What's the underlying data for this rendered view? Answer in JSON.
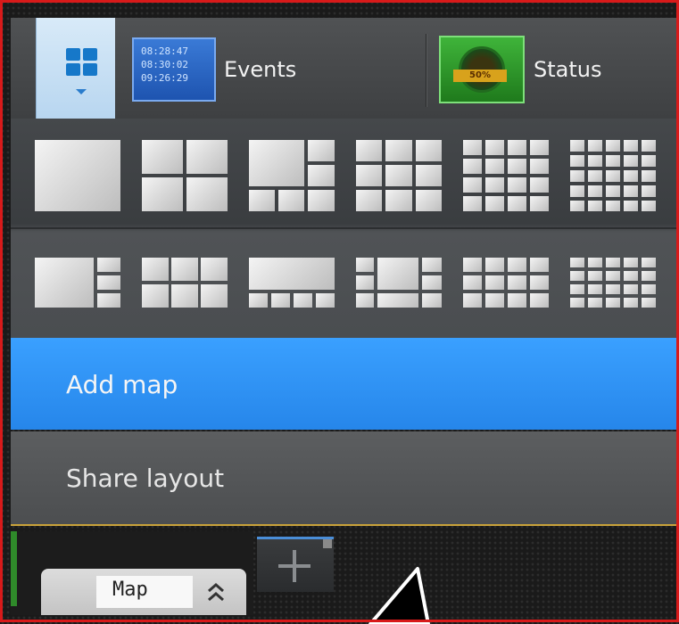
{
  "toolbar": {
    "layout_button": "layout-grid",
    "events": {
      "times": [
        "08:28:47",
        "08:30:02",
        "09:26:29"
      ],
      "label": "Events"
    },
    "status": {
      "percent": "50%",
      "label": "Status"
    }
  },
  "layouts": {
    "row1": [
      "1x1",
      "2x2",
      "1+5",
      "3x3",
      "4x4",
      "5x5"
    ],
    "row2": [
      "1+3 (16:9)",
      "2x2 (16:9)",
      "1+5 (16:9)",
      "3x3 (16:9)",
      "4x4 (16:9)",
      "5x5 (16:9)"
    ]
  },
  "menu": {
    "add_map": "Add map",
    "share_layout": "Share layout"
  },
  "tabs": {
    "map_label": "Map",
    "add_tab_icon": "plus-icon"
  },
  "colors": {
    "accent": "#2d94f6",
    "frame": "#d81a1a",
    "events": "#2a64c4",
    "status": "#2f9a2a"
  }
}
